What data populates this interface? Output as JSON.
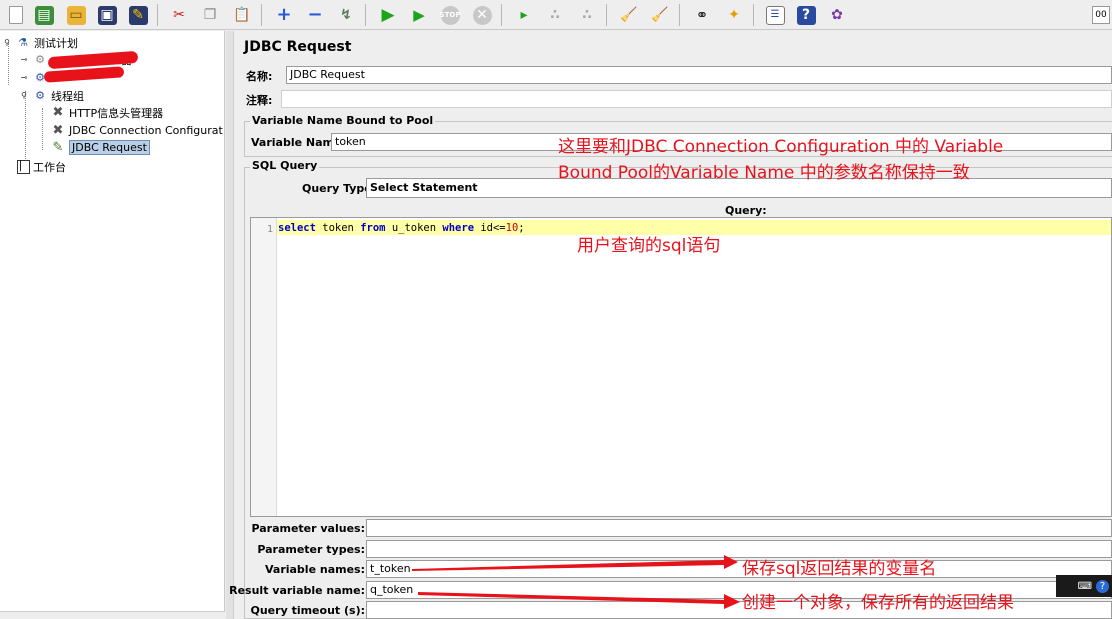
{
  "toolbar": {
    "buttons": [
      "new",
      "templates",
      "open",
      "save",
      "save-as",
      "cut",
      "copy",
      "paste",
      "expand",
      "collapse",
      "toggle",
      "start",
      "start-no-pause",
      "stop",
      "shutdown",
      "remote-start",
      "remote-stop",
      "remote-exit",
      "clear",
      "clear-all",
      "search",
      "reset-search",
      "function-helper",
      "help",
      "log-viewer"
    ],
    "right_label": "00"
  },
  "tree": {
    "items": [
      {
        "label": "测试计划"
      },
      {
        "label": "器"
      },
      {
        "label": ""
      },
      {
        "label": "线程组"
      },
      {
        "label": "HTTP信息头管理器"
      },
      {
        "label": "JDBC Connection Configurat"
      },
      {
        "label": "JDBC Request"
      },
      {
        "label": "工作台"
      }
    ]
  },
  "main": {
    "title": "JDBC Request",
    "name_label": "名称:",
    "name_value": "JDBC Request",
    "comment_label": "注释:",
    "comment_value": "",
    "pool_group_title": "Variable Name Bound to Pool",
    "variable_name_label": "Variable Name:",
    "variable_name_value": "token",
    "sql_group_title": "SQL Query",
    "query_type_label": "Query Type:",
    "query_type_value": "Select Statement",
    "query_header": "Query:",
    "line_number": "1",
    "code": {
      "select": "select",
      "token": " token ",
      "from": "from",
      "table": " u_token ",
      "where": "where",
      "cond": " id<=",
      "num": "10",
      "end": ";"
    },
    "params": [
      {
        "label": "Parameter values:",
        "value": ""
      },
      {
        "label": "Parameter types:",
        "value": ""
      },
      {
        "label": "Variable names:",
        "value": "t_token"
      },
      {
        "label": "Result variable name:",
        "value": "q_token"
      },
      {
        "label": "Query timeout (s):",
        "value": ""
      }
    ]
  },
  "annotations": {
    "note1_line1": "这里要和JDBC Connection Configuration 中的 Variable",
    "note1_line2": "Bound Pool的Variable Name 中的参数名称保持一致",
    "note2": "用户查询的sql语句",
    "note3": "保存sql返回结果的变量名",
    "note4": "创建一个对象，保存所有的返回结果"
  },
  "colors": {
    "annotation": "#e8121b",
    "selection": "#b8cfe5",
    "current_line": "#ffffa8",
    "keyword": "#0000c8"
  }
}
